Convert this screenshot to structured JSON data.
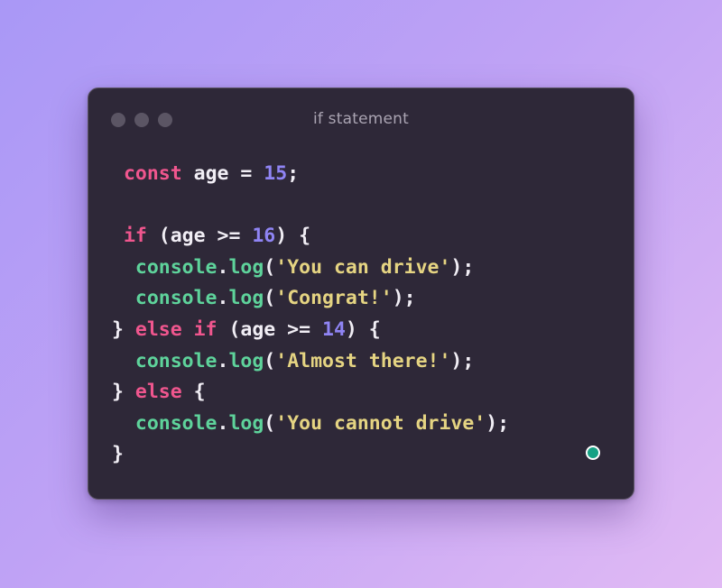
{
  "window": {
    "title": "if statement",
    "controls": [
      "window-dot",
      "window-dot",
      "window-dot"
    ]
  },
  "code": {
    "line1": {
      "kw": "const",
      "t1": " age = ",
      "num": "15",
      "t2": ";"
    },
    "line2": {},
    "line3": {
      "kw": "if",
      "t1": " (age >= ",
      "num": "16",
      "t2": ") {"
    },
    "line4": {
      "fn1": "console",
      "dot": ".",
      "fn2": "log",
      "p1": "(",
      "str": "'You can drive'",
      "p2": ");"
    },
    "line5": {
      "fn1": "console",
      "dot": ".",
      "fn2": "log",
      "p1": "(",
      "str": "'Congrat!'",
      "p2": ");"
    },
    "line6": {
      "t0": "} ",
      "kw": "else if",
      "t1": " (age >= ",
      "num": "14",
      "t2": ") {"
    },
    "line7": {
      "fn1": "console",
      "dot": ".",
      "fn2": "log",
      "p1": "(",
      "str": "'Almost there!'",
      "p2": ");"
    },
    "line8": {
      "t0": "} ",
      "kw": "else",
      "t1": " {"
    },
    "line9": {
      "fn1": "console",
      "dot": ".",
      "fn2": "log",
      "p1": "(",
      "str": "'You cannot drive'",
      "p2": ");"
    },
    "line10": {
      "t0": "}"
    }
  },
  "colors": {
    "background_start": "#a998f6",
    "background_end": "#e1baf4",
    "window_bg": "#2e2838",
    "keyword": "#f0568e",
    "number": "#8f84f4",
    "function": "#5ed39b",
    "string": "#e5d482",
    "status_dot": "#16a184"
  }
}
